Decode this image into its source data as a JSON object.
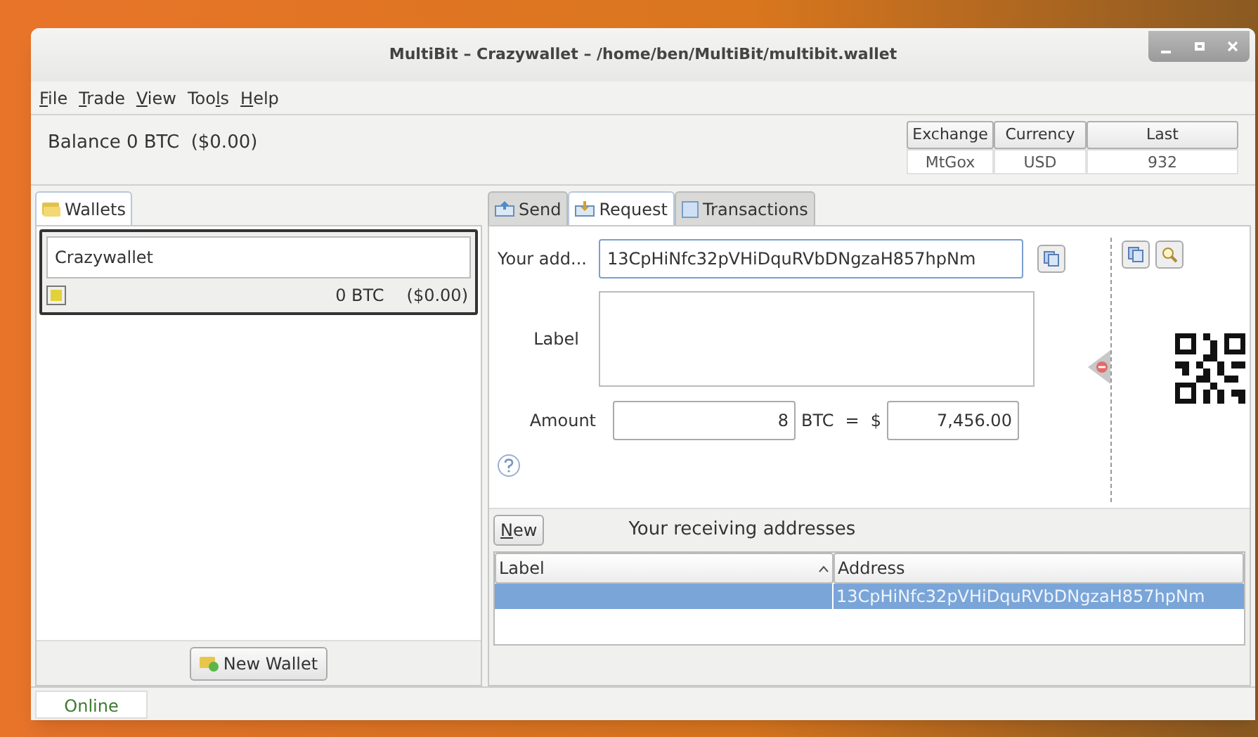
{
  "window": {
    "title": "MultiBit – Crazywallet – /home/ben/MultiBit/multibit.wallet"
  },
  "menu": [
    {
      "key": "F",
      "after": "ile"
    },
    {
      "key": "T",
      "after": "rade"
    },
    {
      "key": "V",
      "after": "iew"
    },
    {
      "before": "Too",
      "key": "l",
      "after": "s"
    },
    {
      "key": "H",
      "after": "elp"
    }
  ],
  "balance": "Balance 0 BTC  ($0.00)",
  "ticker": {
    "columns": [
      "Exchange",
      "Currency",
      "Last"
    ],
    "row": [
      "MtGox",
      "USD",
      "932"
    ]
  },
  "wallets_tab": {
    "label": "Wallets",
    "selected": true
  },
  "wallets": [
    {
      "name": "Crazywallet",
      "btc": "0 BTC",
      "fiat": "($0.00)",
      "selected": true
    }
  ],
  "new_wallet": "New Wallet",
  "tabs": [
    {
      "label": "Send",
      "selected": false,
      "kind": "send"
    },
    {
      "label": "Request",
      "selected": true,
      "kind": "request"
    },
    {
      "label": "Transactions",
      "selected": false,
      "kind": "transactions"
    }
  ],
  "request": {
    "address_label": "Your add...",
    "address": "13CpHiNfc32pVHiDquRVbDNgzaH857hpNm",
    "label_label": "Label",
    "amount_label": "Amount",
    "amount": "8",
    "btc": "BTC",
    "equals": "=",
    "dollar": "$",
    "fiat": "7,456.00"
  },
  "new_button": {
    "key": "N",
    "after": "ew"
  },
  "addresses_title": "Your receiving addresses",
  "table": {
    "columns": [
      "Label",
      "Address"
    ],
    "rows": [
      {
        "address": "13CpHiNfc32pVHiDquRVbDNgzaH857hpNm",
        "selected": true
      }
    ]
  },
  "status_bar": {
    "status": "Online"
  }
}
